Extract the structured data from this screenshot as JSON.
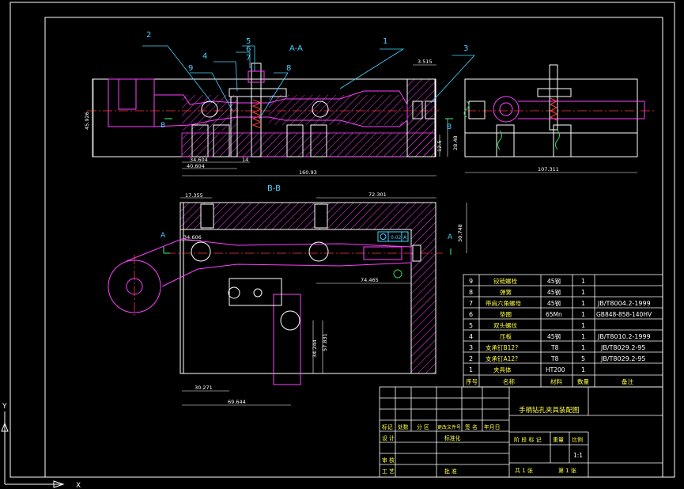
{
  "view_labels": {
    "section_aa": "A-A",
    "section_bb": "B-B",
    "cut_a": "A",
    "cut_b": "B"
  },
  "balloons": [
    {
      "num": "2"
    },
    {
      "num": "5"
    },
    {
      "num": "6"
    },
    {
      "num": "7"
    },
    {
      "num": "1"
    },
    {
      "num": "3"
    },
    {
      "num": "4"
    },
    {
      "num": "9"
    },
    {
      "num": "8"
    }
  ],
  "dimensions": {
    "h_45_926": "45.926",
    "h_3_515": "3.515",
    "d_34_604": "34.604",
    "d_40_604": "40.604",
    "d_14": "14",
    "d_12_5": "12.5",
    "d_28_48": "28.48",
    "d_160_93": "160.93",
    "d_107_311": "107.311",
    "d_17_355": "17.355",
    "d_72_301": "72.301",
    "d_30_748": "30.748",
    "d_34_606": "34.606",
    "d_74_465": "74.465",
    "d_34_244": "34.244",
    "d_57_831": "57.831",
    "d_30_271": "30.271",
    "d_69_644": "69.644",
    "gdt_tol": "0.02",
    "gdt_ref": "A"
  },
  "bom": {
    "headers": [
      "序号",
      "名称",
      "材料",
      "数量",
      "备注"
    ],
    "rows": [
      {
        "no": "9",
        "name": "铰链螺栓",
        "mat": "45钢",
        "qty": "1",
        "note": ""
      },
      {
        "no": "8",
        "name": "弹簧",
        "mat": "45钢",
        "qty": "1",
        "note": ""
      },
      {
        "no": "7",
        "name": "带肩六角螺母",
        "mat": "45钢",
        "qty": "1",
        "note": "JB/T8004.2-1999"
      },
      {
        "no": "6",
        "name": "垫圈",
        "mat": "65Mn",
        "qty": "1",
        "note": "GB848-858-140HV"
      },
      {
        "no": "5",
        "name": "双头螺纹",
        "mat": "",
        "qty": "1",
        "note": ""
      },
      {
        "no": "4",
        "name": "压板",
        "mat": "45钢",
        "qty": "1",
        "note": "JB/T8010.2-1999"
      },
      {
        "no": "3",
        "name": "支承钉B12?",
        "mat": "T8",
        "qty": "1",
        "note": "JB/T8029.2-95"
      },
      {
        "no": "2",
        "name": "支承钉A12?",
        "mat": "T8",
        "qty": "5",
        "note": "JB/T8029.2-95"
      },
      {
        "no": "1",
        "name": "夹具体",
        "mat": "HT200",
        "qty": "1",
        "note": ""
      }
    ]
  },
  "title_block": {
    "title": "手柄钻孔夹具装配图",
    "r_mark": "标记",
    "r_count": "处数",
    "r_zone": "分 区",
    "r_docno": "更改文件号",
    "r_sign": "签 名",
    "r_date": "年月日",
    "design": "设 计",
    "standard": "标准化",
    "stage": "阶 段 标 记",
    "weight": "重量",
    "ratio_label": "比例",
    "ratio": "1:1",
    "check": "审 核",
    "process": "工 艺",
    "approve": "批 准",
    "sheets": "共 1 张",
    "sheet": "第 1 张"
  },
  "colors": {
    "frame": "#ffffff",
    "part": "#ffffff",
    "hatch": "#ff40ff",
    "center": "#ff3b3b",
    "dimension": "#ffffff",
    "leader": "#4ad3ff",
    "text_cn": "#ffff4a",
    "gdt": "#4ad3ff",
    "green_axis": "#32d25a"
  },
  "ucs": {
    "x_label": "X",
    "y_label": "Y"
  }
}
